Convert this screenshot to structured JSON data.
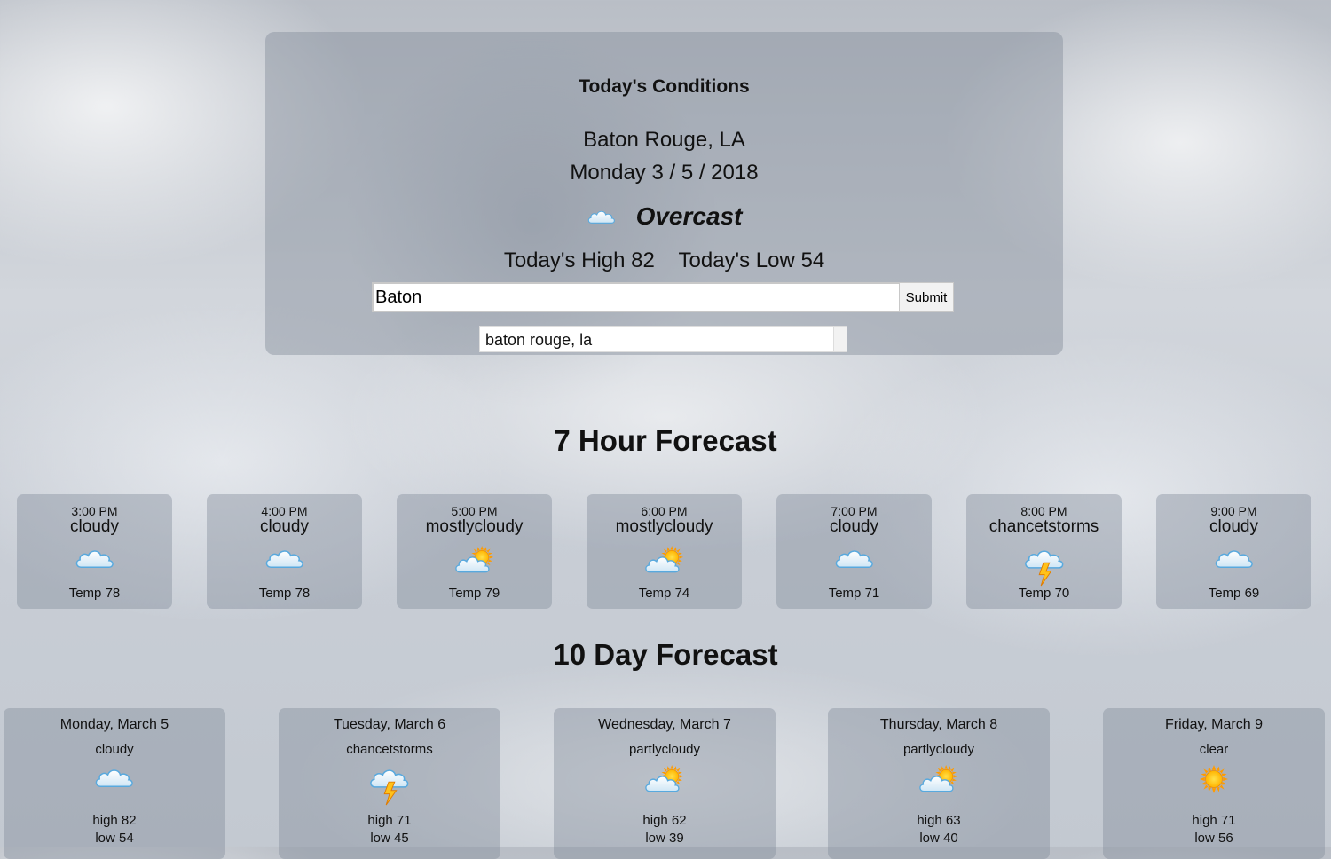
{
  "current": {
    "title": "Today's Conditions",
    "location": "Baton Rouge, LA",
    "date": "Monday  3 / 5 / 2018",
    "condition": "Overcast",
    "condition_icon": "cloudy-icon",
    "high": "Today's High 82",
    "low": "Today's Low 54"
  },
  "search": {
    "value": "Baton",
    "submit_label": "Submit",
    "suggestion": "baton rouge, la"
  },
  "hourly": {
    "title": "7 Hour Forecast",
    "items": [
      {
        "time": "3:00 PM",
        "condition": "cloudy",
        "icon": "cloudy-icon",
        "temp": "Temp 78"
      },
      {
        "time": "4:00 PM",
        "condition": "cloudy",
        "icon": "cloudy-icon",
        "temp": "Temp 78"
      },
      {
        "time": "5:00 PM",
        "condition": "mostlycloudy",
        "icon": "partly-cloudy-icon",
        "temp": "Temp 79"
      },
      {
        "time": "6:00 PM",
        "condition": "mostlycloudy",
        "icon": "partly-cloudy-icon",
        "temp": "Temp 74"
      },
      {
        "time": "7:00 PM",
        "condition": "cloudy",
        "icon": "cloudy-icon",
        "temp": "Temp 71"
      },
      {
        "time": "8:00 PM",
        "condition": "chancetstorms",
        "icon": "thunderstorm-icon",
        "temp": "Temp 70"
      },
      {
        "time": "9:00 PM",
        "condition": "cloudy",
        "icon": "cloudy-icon",
        "temp": "Temp 69"
      }
    ]
  },
  "daily": {
    "title": "10 Day Forecast",
    "items": [
      {
        "date": "Monday, March 5",
        "condition": "cloudy",
        "icon": "cloudy-icon",
        "high": "high 82",
        "low": "low 54"
      },
      {
        "date": "Tuesday, March 6",
        "condition": "chancetstorms",
        "icon": "thunderstorm-icon",
        "high": "high 71",
        "low": "low 45"
      },
      {
        "date": "Wednesday, March 7",
        "condition": "partlycloudy",
        "icon": "partly-cloudy-icon",
        "high": "high 62",
        "low": "low 39"
      },
      {
        "date": "Thursday, March 8",
        "condition": "partlycloudy",
        "icon": "partly-cloudy-icon",
        "high": "high 63",
        "low": "low 40"
      },
      {
        "date": "Friday, March 9",
        "condition": "clear",
        "icon": "sun-icon",
        "high": "high 71",
        "low": "low 56"
      }
    ]
  }
}
